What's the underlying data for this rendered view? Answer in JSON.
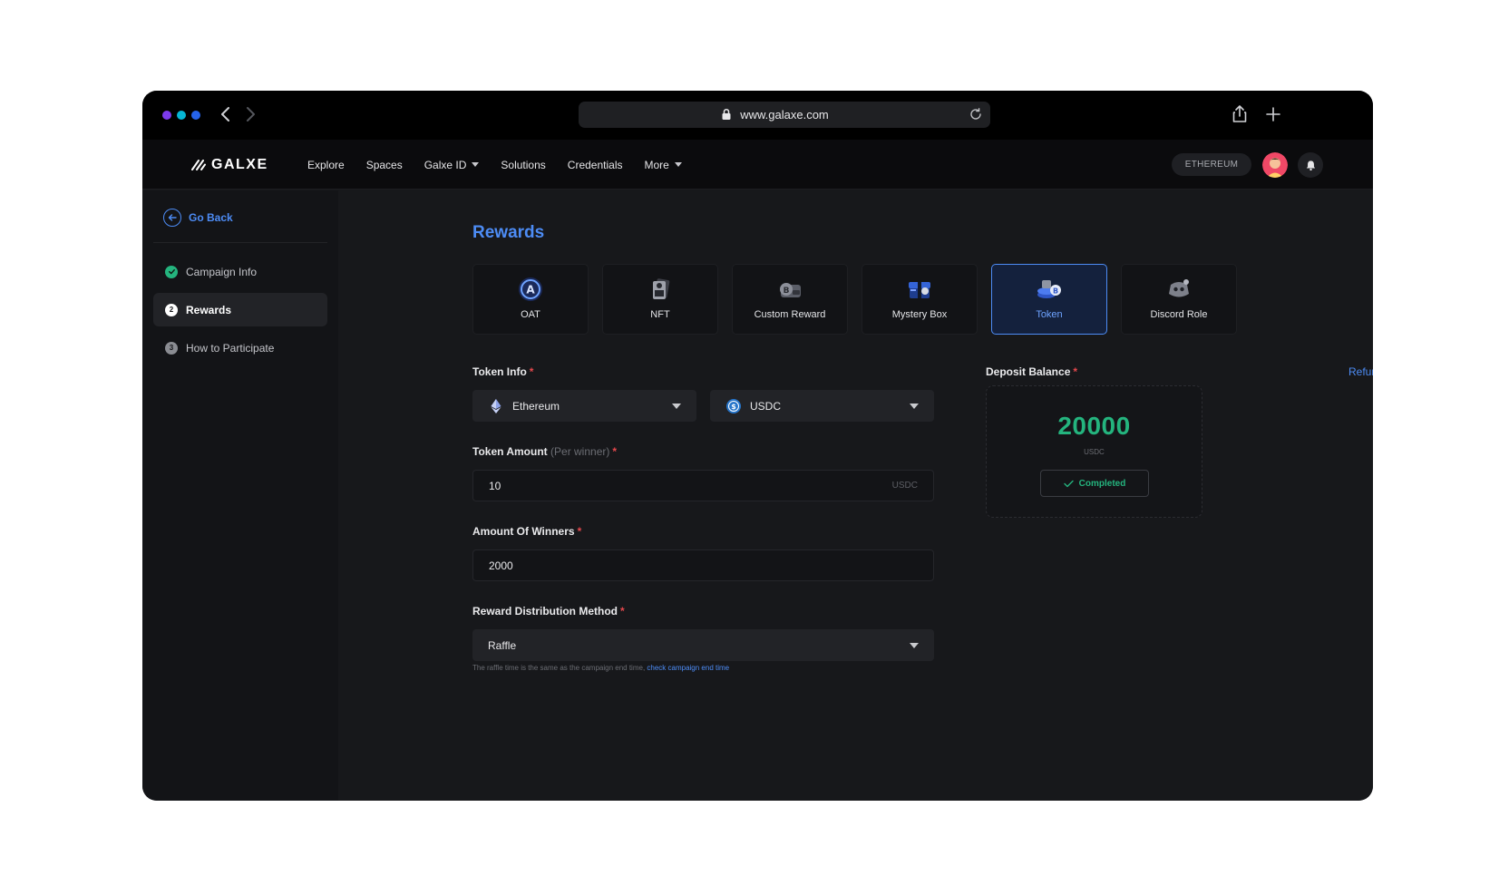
{
  "browser": {
    "url": "www.galaxe.com",
    "traffic_colors": [
      "#7c3aed",
      "#06b6d4",
      "#2563eb"
    ]
  },
  "header": {
    "brand": "GALXE",
    "nav": [
      {
        "label": "Explore",
        "dropdown": false
      },
      {
        "label": "Spaces",
        "dropdown": false
      },
      {
        "label": "Galxe ID",
        "dropdown": true
      },
      {
        "label": "Solutions",
        "dropdown": false
      },
      {
        "label": "Credentials",
        "dropdown": false
      },
      {
        "label": "More",
        "dropdown": true
      }
    ],
    "network": "ETHEREUM"
  },
  "sidebar": {
    "back_label": "Go Back",
    "steps": [
      {
        "label": "Campaign Info",
        "badge": "",
        "state": "done"
      },
      {
        "label": "Rewards",
        "badge": "2",
        "state": "active"
      },
      {
        "label": "How to Participate",
        "badge": "3",
        "state": "pending"
      }
    ]
  },
  "main": {
    "title": "Rewards",
    "reward_types": [
      {
        "label": "OAT",
        "icon": "oat-icon"
      },
      {
        "label": "NFT",
        "icon": "nft-icon"
      },
      {
        "label": "Custom Reward",
        "icon": "custom-reward-icon"
      },
      {
        "label": "Mystery Box",
        "icon": "mystery-box-icon"
      },
      {
        "label": "Token",
        "icon": "token-icon",
        "selected": true
      },
      {
        "label": "Discord Role",
        "icon": "discord-role-icon"
      }
    ],
    "token_info": {
      "label": "Token Info",
      "required": "*",
      "chain": "Ethereum",
      "token": "USDC"
    },
    "token_amount": {
      "label": "Token Amount",
      "hint": "(Per winner)",
      "required": "*",
      "value": "10",
      "unit": "USDC"
    },
    "winners": {
      "label": "Amount Of Winners",
      "required": "*",
      "value": "2000"
    },
    "distribution": {
      "label": "Reward Distribution Method",
      "required": "*",
      "value": "Raffle",
      "note": "The raffle time is the same as the campaign end time, ",
      "note_link": "check campaign end time"
    },
    "deposit": {
      "label": "Deposit Balance",
      "required": "*",
      "refund_label": "Refund",
      "amount": "20000",
      "unit": "USDC",
      "status": "Completed"
    }
  },
  "colors": {
    "accent": "#4d8cf5",
    "success": "#24b47e",
    "required": "#e5484d"
  }
}
